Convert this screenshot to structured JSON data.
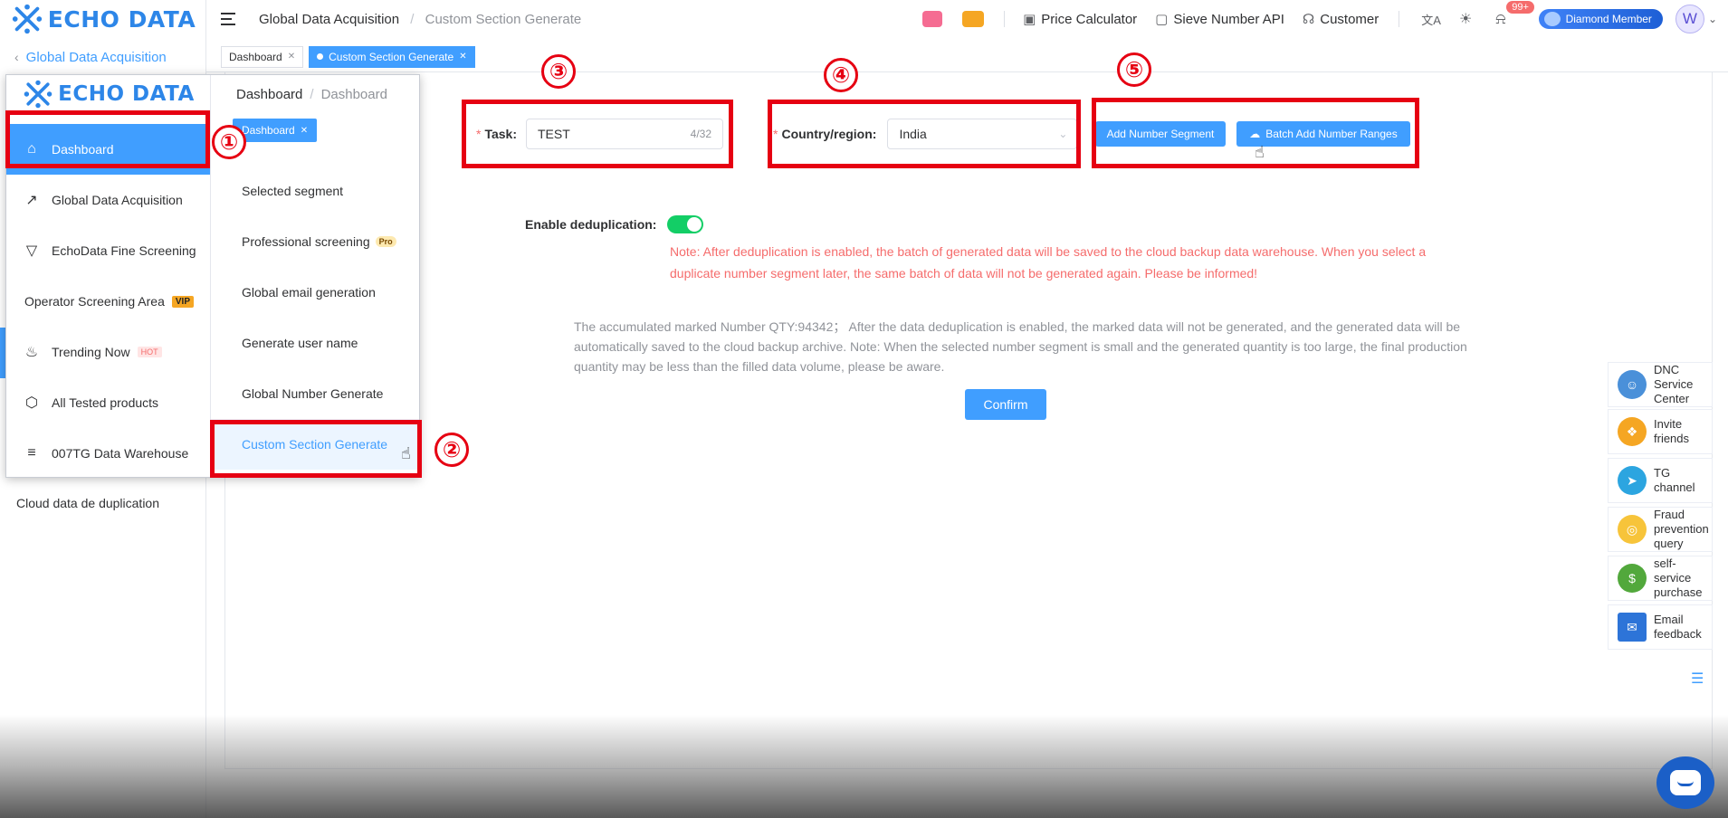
{
  "brand": {
    "logo_text": "ECHO DATA"
  },
  "sidebar": {
    "back_label": "Global Data Acquisition",
    "cloud_label": "Cloud data de duplication"
  },
  "header": {
    "breadcrumb": [
      "Global Data Acquisition",
      "Custom Section Generate"
    ],
    "price_calculator": "Price Calculator",
    "sieve_api": "Sieve Number API",
    "customer": "Customer",
    "notif_badge": "99+",
    "member": "Diamond Member",
    "avatar_letter": "W"
  },
  "tabs": [
    {
      "label": "Dashboard"
    },
    {
      "label": "Custom Section Generate"
    }
  ],
  "popup": {
    "menu": [
      {
        "label": "Dashboard"
      },
      {
        "label": "Global Data Acquisition"
      },
      {
        "label": "EchoData Fine Screening"
      },
      {
        "label": "Operator Screening Area",
        "badge": "VIP"
      },
      {
        "label": "Trending Now",
        "badge": "HOT"
      },
      {
        "label": "All Tested products"
      },
      {
        "label": "007TG Data Warehouse"
      }
    ],
    "breadcrumb": [
      "Dashboard",
      "Dashboard"
    ],
    "tab": "Dashboard",
    "submenu": [
      {
        "label": "Selected segment"
      },
      {
        "label": "Professional screening",
        "badge": "Pro"
      },
      {
        "label": "Global email generation"
      },
      {
        "label": "Generate user name"
      },
      {
        "label": "Global Number Generate"
      },
      {
        "label": "Custom Section Generate"
      }
    ]
  },
  "form": {
    "task_label": "Task:",
    "task_value": "TEST",
    "task_count": "4/32",
    "country_label": "Country/region:",
    "country_value": "India",
    "add_segment": "Add Number Segment",
    "batch_add": "Batch Add Number Ranges",
    "dedup_label": "Enable deduplication:",
    "dedup_on": true,
    "note": "Note: After deduplication is enabled, the batch of generated data will be saved to the cloud backup data warehouse. When you select a duplicate number segment later, the same batch of data will not be generated again. Please be informed!",
    "info": "The accumulated marked Number QTY:94342； After the data deduplication is enabled, the marked data will not be generated, and the generated data will be automatically saved to the cloud backup archive. Note: When the selected number segment is small and the generated quantity is too large, the final production quantity may be less than the filled data volume, please be aware.",
    "confirm": "Confirm"
  },
  "annotations": [
    "①",
    "②",
    "③",
    "④",
    "⑤"
  ],
  "service_panel": [
    {
      "label": "DNC Service Center",
      "icon": "people-icon",
      "color": "#4a90d9"
    },
    {
      "label": "Invite friends",
      "icon": "gift-icon",
      "color": "#f5a623"
    },
    {
      "label": "TG channel",
      "icon": "telegram-icon",
      "color": "#2ca5e0"
    },
    {
      "label": "Fraud prevention query",
      "icon": "search-coin-icon",
      "color": "#f7c43a"
    },
    {
      "label": "self-service purchase",
      "icon": "money-bag-icon",
      "color": "#52a83c"
    },
    {
      "label": "Email feedback",
      "icon": "mail-icon",
      "color": "#2d74d8"
    }
  ],
  "colors": {
    "accent": "#409eff",
    "highlight": "#e60012",
    "danger": "#f56c6c",
    "toggle_on": "#13ce66"
  }
}
